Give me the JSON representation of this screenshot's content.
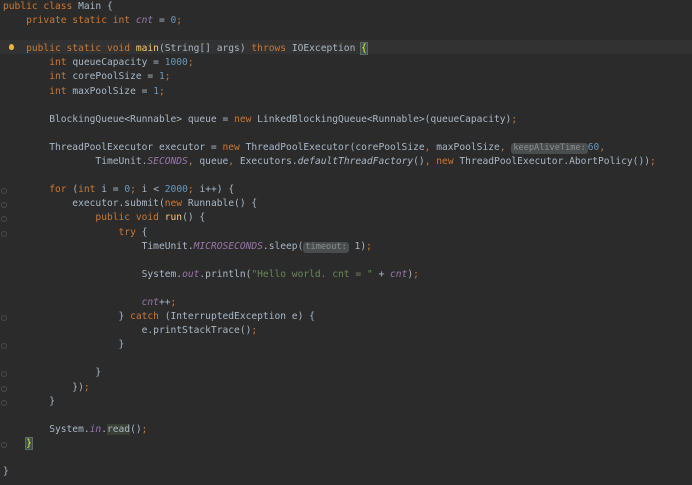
{
  "editor": {
    "language": "java",
    "theme_colors": {
      "background": "#2b2b2b",
      "keyword": "#cc7832",
      "number": "#6897bb",
      "string": "#6a8759",
      "method_declaration": "#ffc66d",
      "field": "#9876aa",
      "default_text": "#a9b7c6"
    },
    "lines": [
      {
        "segments": [
          {
            "t": "public class ",
            "c": "kw"
          },
          {
            "t": "Main {",
            "c": ""
          }
        ]
      },
      {
        "segments": [
          {
            "t": "    private static int ",
            "c": "kw"
          },
          {
            "t": "cnt",
            "c": "static-field"
          },
          {
            "t": " = ",
            "c": ""
          },
          {
            "t": "0",
            "c": "num"
          },
          {
            "t": ";",
            "c": "kw"
          }
        ]
      },
      {
        "segments": []
      },
      {
        "bulb": true,
        "segments": [
          {
            "t": "    public static void ",
            "c": "kw"
          },
          {
            "t": "main",
            "c": "fn"
          },
          {
            "t": "(String[] args) ",
            "c": ""
          },
          {
            "t": "throws ",
            "c": "kw"
          },
          {
            "t": "IOException ",
            "c": ""
          },
          {
            "t": "{",
            "c": "brace-match"
          }
        ]
      },
      {
        "segments": [
          {
            "t": "        int ",
            "c": "kw"
          },
          {
            "t": "queueCapacity = ",
            "c": ""
          },
          {
            "t": "1000",
            "c": "num"
          },
          {
            "t": ";",
            "c": "kw"
          }
        ]
      },
      {
        "segments": [
          {
            "t": "        int ",
            "c": "kw"
          },
          {
            "t": "corePoolSize = ",
            "c": ""
          },
          {
            "t": "1",
            "c": "num"
          },
          {
            "t": ";",
            "c": "kw"
          }
        ]
      },
      {
        "segments": [
          {
            "t": "        int ",
            "c": "kw"
          },
          {
            "t": "maxPoolSize = ",
            "c": ""
          },
          {
            "t": "1",
            "c": "num"
          },
          {
            "t": ";",
            "c": "kw"
          }
        ]
      },
      {
        "segments": []
      },
      {
        "segments": [
          {
            "t": "        BlockingQueue<Runnable> queue = ",
            "c": ""
          },
          {
            "t": "new ",
            "c": "kw"
          },
          {
            "t": "LinkedBlockingQueue<Runnable>(queueCapacity)",
            "c": ""
          },
          {
            "t": ";",
            "c": "kw"
          }
        ]
      },
      {
        "segments": []
      },
      {
        "segments": [
          {
            "t": "        ThreadPoolExecutor executor = ",
            "c": ""
          },
          {
            "t": "new ",
            "c": "kw"
          },
          {
            "t": "ThreadPoolExecutor(corePoolSize",
            "c": ""
          },
          {
            "t": ", ",
            "c": "kw"
          },
          {
            "t": "maxPoolSize",
            "c": ""
          },
          {
            "t": ", ",
            "c": "kw"
          },
          {
            "t": "keepAliveTime:",
            "c": "hint"
          },
          {
            "t": "60",
            "c": "num"
          },
          {
            "t": ",",
            "c": "kw"
          }
        ]
      },
      {
        "segments": [
          {
            "t": "                TimeUnit.",
            "c": ""
          },
          {
            "t": "SECONDS",
            "c": "static-field"
          },
          {
            "t": ", ",
            "c": "kw"
          },
          {
            "t": "queue",
            "c": ""
          },
          {
            "t": ", ",
            "c": "kw"
          },
          {
            "t": "Executors.",
            "c": ""
          },
          {
            "t": "defaultThreadFactory",
            "c": "static-call"
          },
          {
            "t": "()",
            "c": ""
          },
          {
            "t": ", ",
            "c": "kw"
          },
          {
            "t": "new ",
            "c": "kw"
          },
          {
            "t": "ThreadPoolExecutor.AbortPolicy())",
            "c": ""
          },
          {
            "t": ";",
            "c": "kw"
          }
        ]
      },
      {
        "segments": []
      },
      {
        "fold": true,
        "segments": [
          {
            "t": "        for ",
            "c": "kw"
          },
          {
            "t": "(",
            "c": ""
          },
          {
            "t": "int ",
            "c": "kw"
          },
          {
            "t": "i = ",
            "c": ""
          },
          {
            "t": "0",
            "c": "num"
          },
          {
            "t": "; ",
            "c": "kw"
          },
          {
            "t": "i < ",
            "c": ""
          },
          {
            "t": "2000",
            "c": "num"
          },
          {
            "t": "; ",
            "c": "kw"
          },
          {
            "t": "i++) {",
            "c": ""
          }
        ]
      },
      {
        "fold": true,
        "segments": [
          {
            "t": "            executor.submit(",
            "c": ""
          },
          {
            "t": "new ",
            "c": "kw"
          },
          {
            "t": "Runnable() {",
            "c": ""
          }
        ]
      },
      {
        "fold": true,
        "segments": [
          {
            "t": "                public void ",
            "c": "kw"
          },
          {
            "t": "run",
            "c": "fn"
          },
          {
            "t": "() {",
            "c": ""
          }
        ]
      },
      {
        "fold": true,
        "segments": [
          {
            "t": "                    try ",
            "c": "kw"
          },
          {
            "t": "{",
            "c": ""
          }
        ]
      },
      {
        "segments": [
          {
            "t": "                        TimeUnit.",
            "c": ""
          },
          {
            "t": "MICROSECONDS",
            "c": "static-field"
          },
          {
            "t": ".sleep(",
            "c": ""
          },
          {
            "t": "timeout:",
            "c": "hint"
          },
          {
            "t": " 1)",
            "c": ""
          },
          {
            "t": ";",
            "c": "kw"
          }
        ]
      },
      {
        "segments": []
      },
      {
        "segments": [
          {
            "t": "                        System.",
            "c": ""
          },
          {
            "t": "out",
            "c": "static-field"
          },
          {
            "t": ".println(",
            "c": ""
          },
          {
            "t": "\"Hello world. cnt = \" ",
            "c": "str"
          },
          {
            "t": "+ ",
            "c": ""
          },
          {
            "t": "cnt",
            "c": "static-field"
          },
          {
            "t": ")",
            "c": ""
          },
          {
            "t": ";",
            "c": "kw"
          }
        ]
      },
      {
        "segments": []
      },
      {
        "segments": [
          {
            "t": "                        ",
            "c": ""
          },
          {
            "t": "cnt",
            "c": "static-field"
          },
          {
            "t": "++",
            "c": ""
          },
          {
            "t": ";",
            "c": "kw"
          }
        ]
      },
      {
        "fold": true,
        "segments": [
          {
            "t": "                    } ",
            "c": ""
          },
          {
            "t": "catch ",
            "c": "kw"
          },
          {
            "t": "(InterruptedException e) {",
            "c": ""
          }
        ]
      },
      {
        "segments": [
          {
            "t": "                        e.printStackTrace()",
            "c": ""
          },
          {
            "t": ";",
            "c": "kw"
          }
        ]
      },
      {
        "fold": true,
        "segments": [
          {
            "t": "                    }",
            "c": ""
          }
        ]
      },
      {
        "segments": []
      },
      {
        "fold": true,
        "segments": [
          {
            "t": "                }",
            "c": ""
          }
        ]
      },
      {
        "fold": true,
        "segments": [
          {
            "t": "            })",
            "c": ""
          },
          {
            "t": ";",
            "c": "kw"
          }
        ]
      },
      {
        "fold": true,
        "segments": [
          {
            "t": "        }",
            "c": ""
          }
        ]
      },
      {
        "segments": []
      },
      {
        "segments": [
          {
            "t": "        System.",
            "c": ""
          },
          {
            "t": "in",
            "c": "static-field"
          },
          {
            "t": ".",
            "c": ""
          },
          {
            "t": "read",
            "c": "read-hl"
          },
          {
            "t": "()",
            "c": ""
          },
          {
            "t": ";",
            "c": "kw"
          }
        ]
      },
      {
        "fold": true,
        "segments": [
          {
            "t": "    ",
            "c": ""
          },
          {
            "t": "}",
            "c": "brace-match"
          }
        ]
      },
      {
        "segments": []
      },
      {
        "segments": [
          {
            "t": "}",
            "c": ""
          }
        ]
      }
    ]
  }
}
